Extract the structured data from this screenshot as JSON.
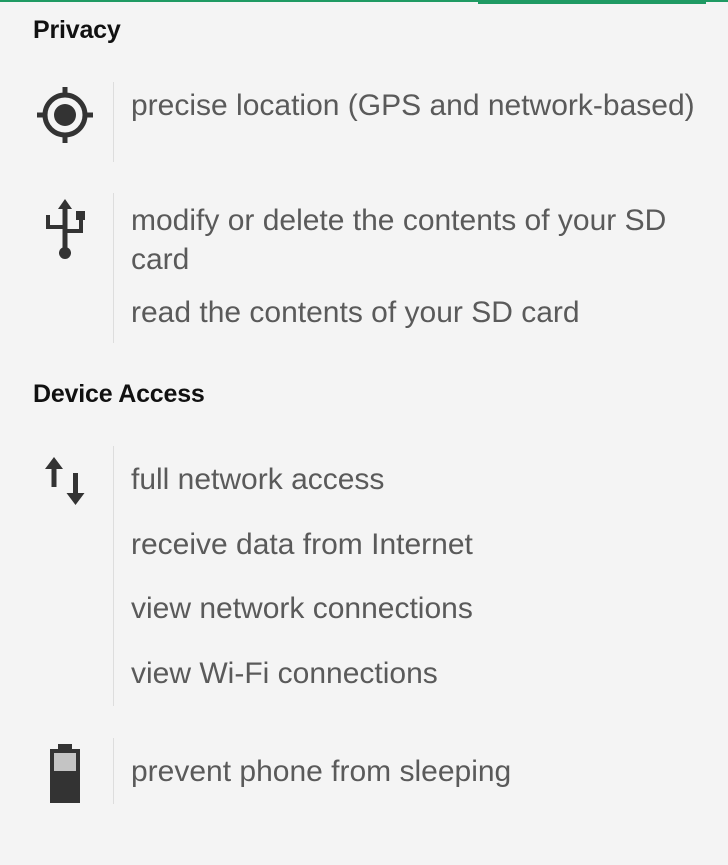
{
  "accent_color": "#1f9a63",
  "sections": {
    "privacy": {
      "title": "Privacy",
      "location": {
        "icon": "location-crosshair-icon",
        "items": [
          "precise location (GPS and network-based)"
        ]
      },
      "storage": {
        "icon": "usb-icon",
        "items": [
          "modify or delete the contents of your SD card",
          "read the contents of your SD card"
        ]
      }
    },
    "device_access": {
      "title": "Device Access",
      "network": {
        "icon": "network-arrows-icon",
        "items": [
          "full network access",
          "receive data from Internet",
          "view network connections",
          "view Wi-Fi connections"
        ]
      },
      "power": {
        "icon": "battery-icon",
        "items": [
          "prevent phone from sleeping"
        ]
      }
    }
  }
}
